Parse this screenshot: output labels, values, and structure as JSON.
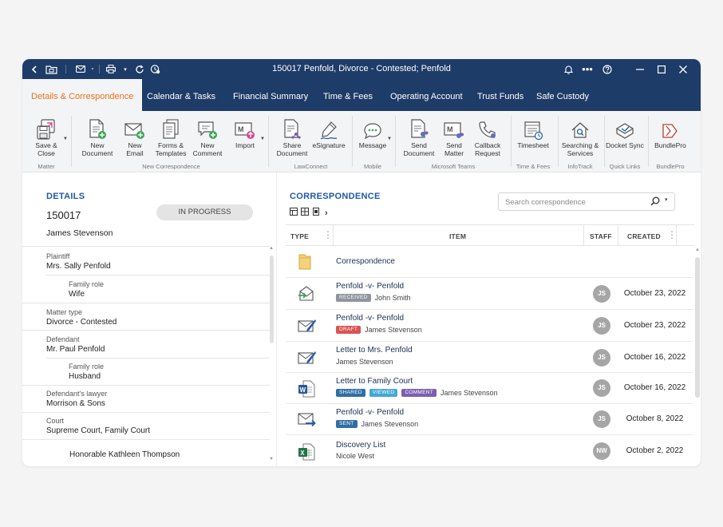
{
  "window": {
    "title": "150017 Penfold, Divorce - Contested; Penfold"
  },
  "nav_tabs": [
    {
      "label": "Details & Correspondence",
      "active": true
    },
    {
      "label": "Calendar & Tasks"
    },
    {
      "label": "Financial Summary"
    },
    {
      "label": "Time & Fees"
    },
    {
      "label": "Operating Account"
    },
    {
      "label": "Trust Funds"
    },
    {
      "label": "Safe Custody"
    }
  ],
  "ribbon": {
    "buttons": [
      {
        "label": "Save &\nClose",
        "icon": "save-close-icon"
      },
      {
        "label": "New\nDocument",
        "icon": "new-document-icon"
      },
      {
        "label": "New\nEmail",
        "icon": "new-email-icon"
      },
      {
        "label": "Forms &\nTemplates",
        "icon": "forms-templates-icon"
      },
      {
        "label": "New\nComment",
        "icon": "new-comment-icon"
      },
      {
        "label": "Import",
        "icon": "import-icon"
      },
      {
        "label": "Share\nDocument",
        "icon": "share-document-icon"
      },
      {
        "label": "eSignature",
        "icon": "esignature-icon"
      },
      {
        "label": "Message",
        "icon": "message-icon"
      },
      {
        "label": "Send\nDocument",
        "icon": "send-document-icon"
      },
      {
        "label": "Send\nMatter",
        "icon": "send-matter-icon"
      },
      {
        "label": "Callback\nRequest",
        "icon": "callback-request-icon"
      },
      {
        "label": "Timesheet",
        "icon": "timesheet-icon"
      },
      {
        "label": "Searching &\nServices",
        "icon": "searching-services-icon"
      },
      {
        "label": "Docket Sync",
        "icon": "docket-sync-icon"
      },
      {
        "label": "BundlePro",
        "icon": "bundlepro-icon"
      }
    ],
    "groups": [
      {
        "label": "Matter"
      },
      {
        "label": "New Correspondence"
      },
      {
        "label": "LawConnect"
      },
      {
        "label": "Mobile"
      },
      {
        "label": "Microsoft Teams"
      },
      {
        "label": "Time & Fees"
      },
      {
        "label": "InfoTrack"
      },
      {
        "label": "Quick Links"
      },
      {
        "label": "BundlePro"
      }
    ]
  },
  "details": {
    "heading": "DETAILS",
    "matter_number": "150017",
    "status": "IN PROGRESS",
    "client": "James Stevenson",
    "fields": [
      {
        "label": "Plaintiff",
        "value": "Mrs. Sally Penfold",
        "indent": false
      },
      {
        "label": "Family role",
        "value": "Wife",
        "indent": true
      },
      {
        "label": "Matter type",
        "value": "Divorce - Contested",
        "indent": false
      },
      {
        "label": "Defendant",
        "value": "Mr. Paul Penfold",
        "indent": false
      },
      {
        "label": "Family role",
        "value": "Husband",
        "indent": true
      },
      {
        "label": "Defendant's lawyer",
        "value": "Morrison & Sons",
        "indent": false
      },
      {
        "label": "Court",
        "value": "Supreme Court, Family Court",
        "indent": false
      },
      {
        "label": "",
        "value": "Honorable Kathleen Thompson",
        "indent": true
      }
    ]
  },
  "correspondence": {
    "heading": "CORRESPONDENCE",
    "search_placeholder": "Search correspondence",
    "columns": {
      "type": "TYPE",
      "item": "ITEM",
      "staff": "STAFF",
      "created": "CREATED"
    },
    "rows": [
      {
        "icon": "folder-icon",
        "title": "Correspondence",
        "badges": [],
        "person": "",
        "staff": "",
        "date": ""
      },
      {
        "icon": "received-email-icon",
        "title": "Penfold -v- Penfold",
        "badges": [
          {
            "label": "RECEIVED",
            "color": "#8e959d"
          }
        ],
        "person": "John Smith",
        "staff": "JS",
        "date": "October 23, 2022"
      },
      {
        "icon": "draft-email-icon",
        "title": "Penfold -v- Penfold",
        "badges": [
          {
            "label": "DRAFT",
            "color": "#d9534f"
          }
        ],
        "person": "James Stevenson",
        "staff": "JS",
        "date": "October 23, 2022"
      },
      {
        "icon": "draft-email-icon",
        "title": "Letter to Mrs. Penfold",
        "badges": [],
        "person": "James Stevenson",
        "staff": "JS",
        "date": "October 16, 2022"
      },
      {
        "icon": "word-document-icon",
        "title": "Letter to Family Court",
        "badges": [
          {
            "label": "SHARED",
            "color": "#2f6ea5"
          },
          {
            "label": "VIEWED",
            "color": "#45a8d6"
          },
          {
            "label": "COMMENT",
            "color": "#7b5fb0"
          }
        ],
        "person": "James Stevenson",
        "staff": "JS",
        "date": "October 16, 2022"
      },
      {
        "icon": "sent-email-icon",
        "title": "Penfold -v- Penfold",
        "badges": [
          {
            "label": "SENT",
            "color": "#2f6ea5"
          }
        ],
        "person": "James Stevenson",
        "staff": "JS",
        "date": "October 8, 2022"
      },
      {
        "icon": "excel-document-icon",
        "title": "Discovery List",
        "badges": [],
        "person": "Nicole West",
        "staff": "NW",
        "date": "October 2, 2022"
      }
    ]
  },
  "colors": {
    "titlebar": "#1e3c68",
    "accent": "#e8731a",
    "heading": "#1f5aa6"
  }
}
